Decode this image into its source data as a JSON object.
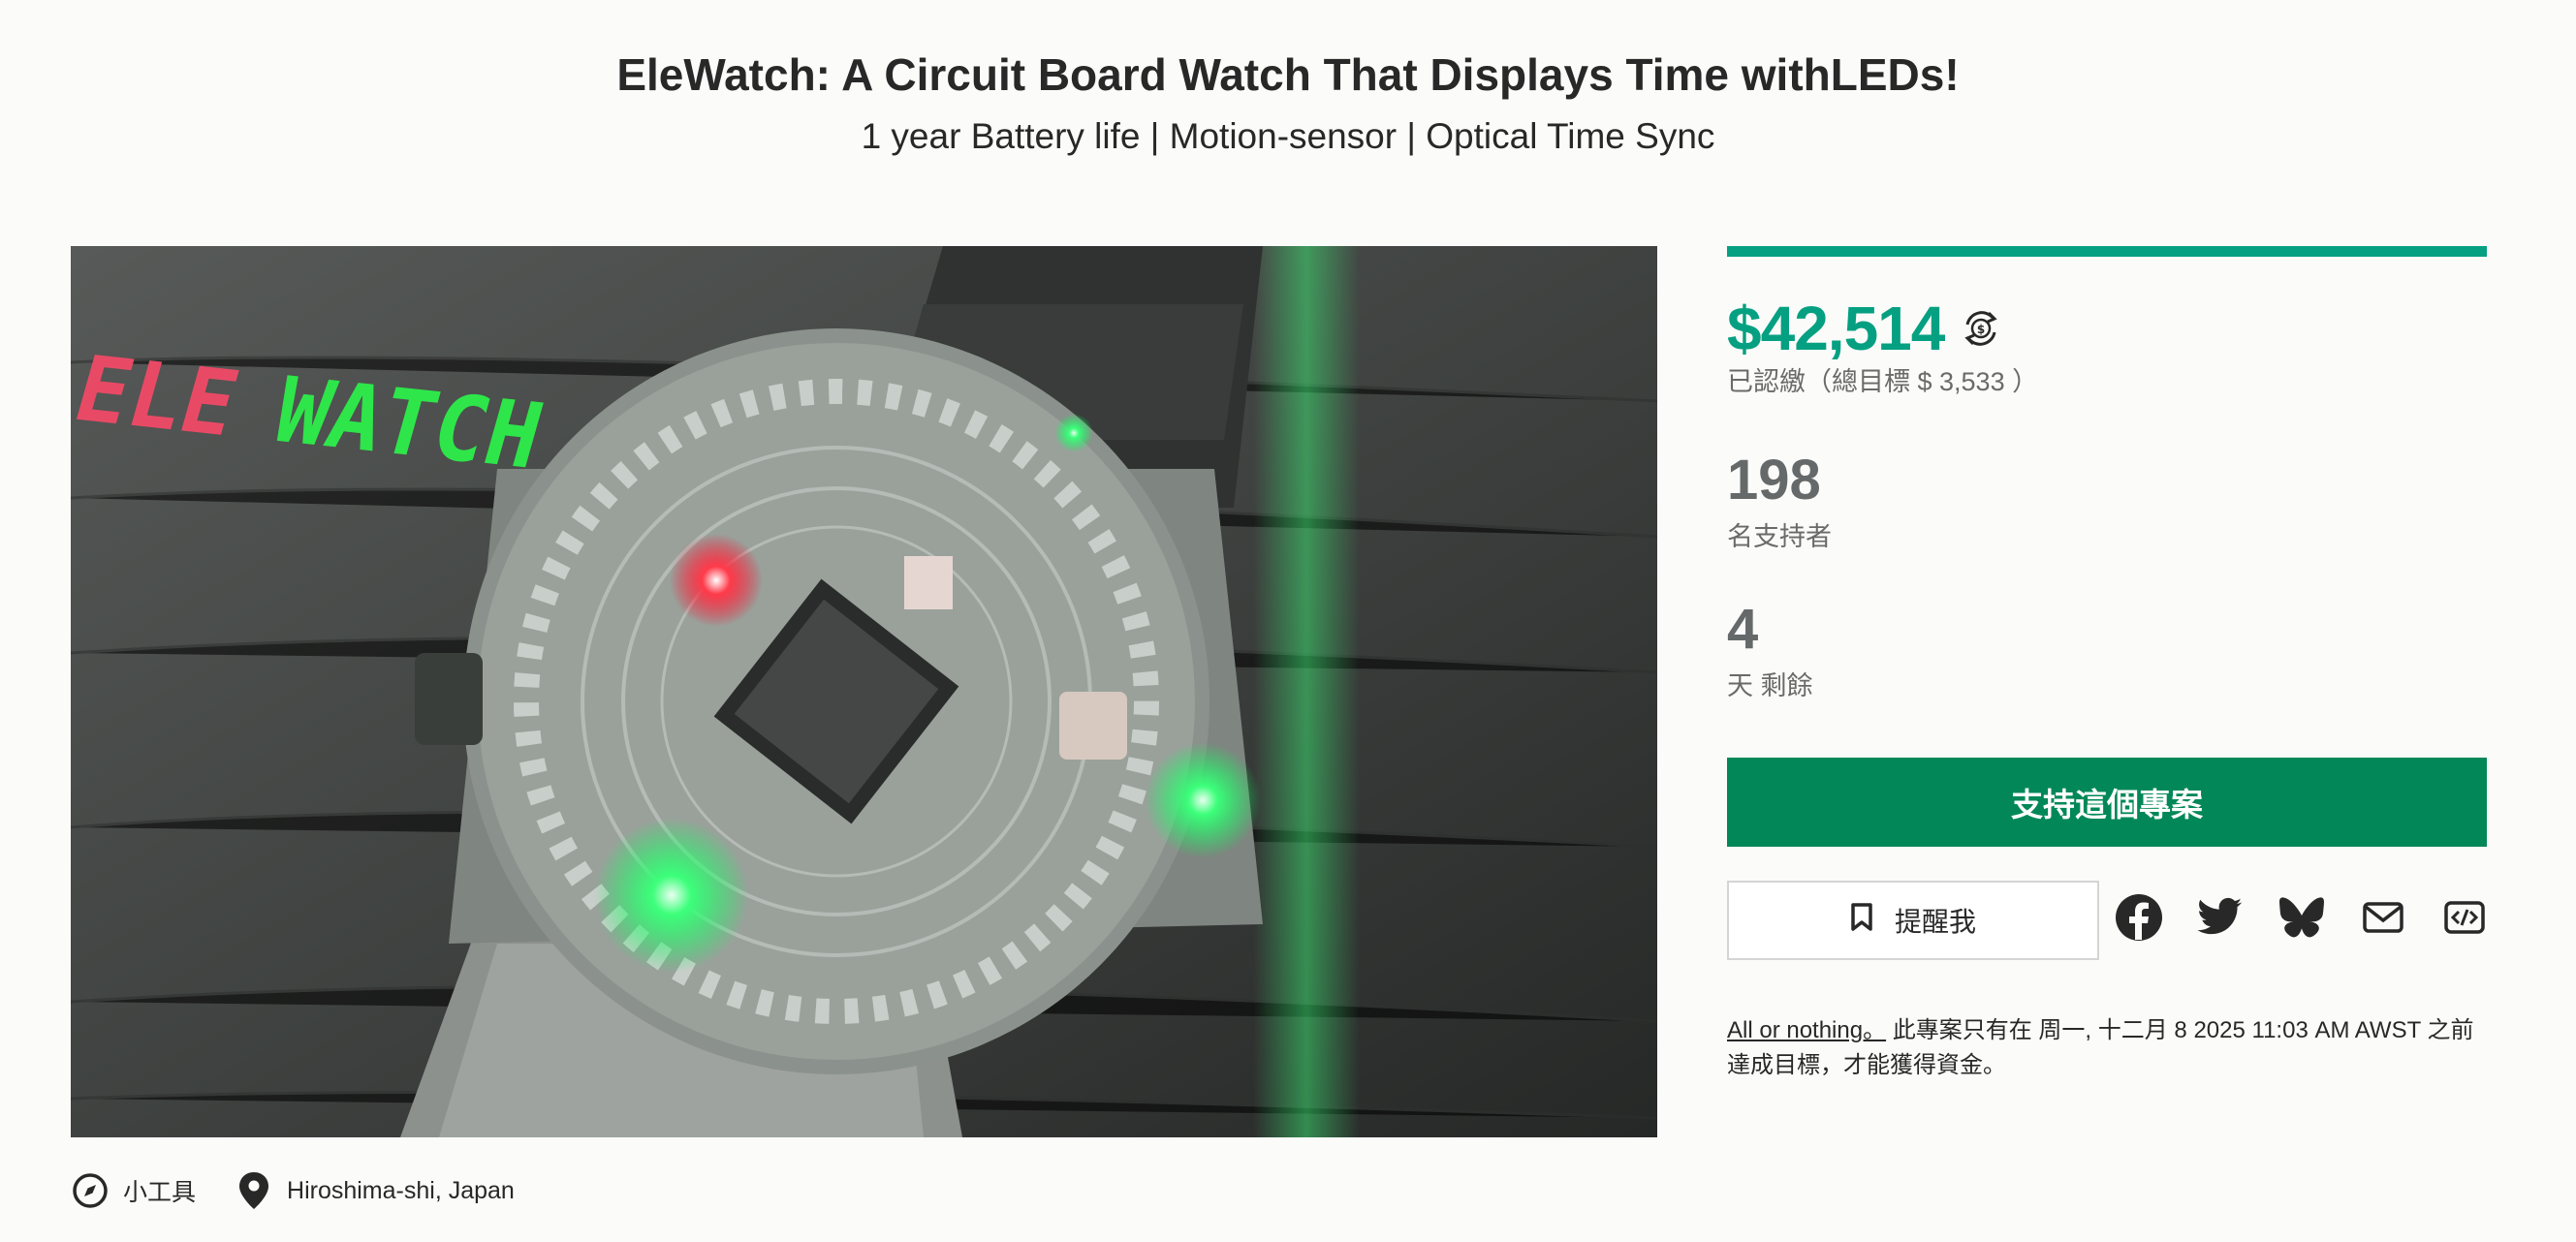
{
  "project": {
    "title": "EleWatch: A Circuit Board Watch That Displays Time withLEDs!",
    "subtitle": "1 year Battery life | Motion-sensor | Optical Time Sync"
  },
  "hero": {
    "logo_part1": "ELE",
    "logo_part2": "WATCH",
    "logo_colors": [
      "#e84a66",
      "#2ee64a"
    ]
  },
  "meta": {
    "category": "小工具",
    "category_icon": "compass-icon",
    "location": "Hiroshima-shi, Japan",
    "location_icon": "map-pin-icon"
  },
  "funding": {
    "progress": 1.0,
    "pledged": "$42,514",
    "pledged_label": "已認繳（總目標 $ 3,533 ）",
    "backers": "198",
    "backers_label": "名支持者",
    "days_left": "4",
    "days_label": "天 剩餘",
    "back_button": "支持這個專案",
    "remind_button": "提醒我",
    "model": "All or nothing。",
    "deadline_text": "此專案只有在 周一, 十二月 8 2025 11:03 AM AWST 之前達成目標，才能獲得資金。"
  },
  "share": [
    "facebook-icon",
    "twitter-icon",
    "bluesky-icon",
    "email-icon",
    "embed-icon"
  ],
  "colors": {
    "accent": "#05a081",
    "button": "#028858",
    "text": "#282828",
    "muted": "#6a6a6a"
  }
}
